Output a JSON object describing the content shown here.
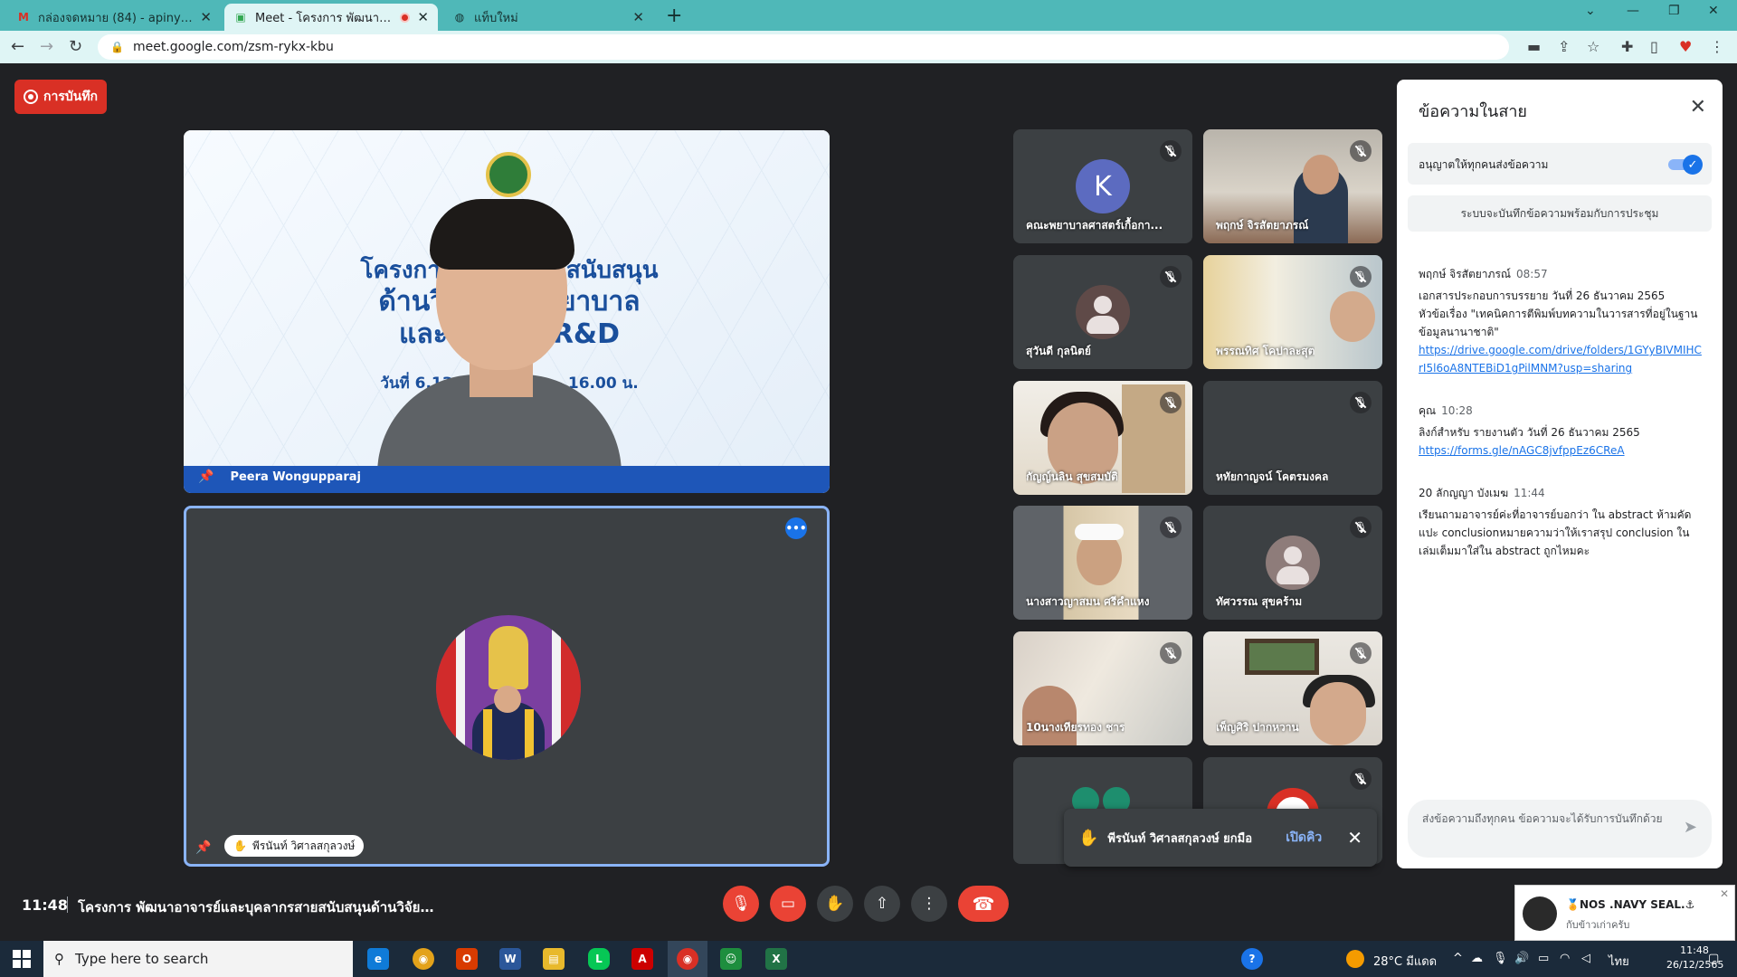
{
  "browser": {
    "tabs": [
      {
        "title": "กล่องจดหมาย (84) - apinya.kae@n",
        "favicon": "gmail-icon"
      },
      {
        "title": "Meet - โครงการ พัฒนาอาจารย์",
        "favicon": "meet-icon",
        "recording": true
      },
      {
        "title": "แท็บใหม่",
        "favicon": "globe-icon"
      }
    ],
    "url": "meet.google.com/zsm-rykx-kbu"
  },
  "meet": {
    "record_label": "การบันทึก",
    "main_tile": {
      "name": "Peera Wongupparaj",
      "slide": {
        "line1": "โครงการพัฒ          กรสายสนับสนุน",
        "line2": "ด้านวิจัยเ              การพยาบาล",
        "line3": "และการ            2R R&D",
        "line4": "วันที่ 6,13,19,2             .00 น. - 16.00 น."
      }
    },
    "second_tile": {
      "name": "พีรนันท์ วิศาลสกุลวงษ์"
    },
    "grid": [
      {
        "name": "คณะพยาบาลศาสตร์เกื้อกา...",
        "type": "letter",
        "letter": "K"
      },
      {
        "name": "พฤกษ์ จิรสัตยาภรณ์",
        "type": "office"
      },
      {
        "name": "สุวันดี กุลนิตย์",
        "type": "person"
      },
      {
        "name": "พรรณทิศ โคปาละสุต",
        "type": "room"
      },
      {
        "name": "กัญญ์นลิน สุขสมบัติ",
        "type": "shelf"
      },
      {
        "name": "หทัยกาญจน์ โคตรมงคล",
        "type": "blank"
      },
      {
        "name": "นางสาวญาสมน ศรีคำแหง",
        "type": "nurse"
      },
      {
        "name": "ทัศวรรณ สุขคร้าม",
        "type": "person2"
      },
      {
        "name": "10นางเทียรทอง ชาร",
        "type": "wall"
      },
      {
        "name": "เพ็ญศิริ ปากหวาน",
        "type": "art"
      },
      {
        "name": "",
        "type": "group"
      },
      {
        "name": "",
        "type": "red"
      }
    ],
    "toast": {
      "message": "พีรนันท์ วิศาลสกุลวงษ์ ยกมือ",
      "action": "เปิดคิว"
    },
    "chat": {
      "title": "ข้อความในสาย",
      "permission_label": "อนุญาตให้ทุกคนส่งข้อความ",
      "info": "ระบบจะบันทึกข้อความพร้อมกับการประชุม",
      "messages": [
        {
          "sender": "พฤกษ์ จิรสัตยาภรณ์",
          "time": "08:57",
          "lines": [
            "เอกสารประกอบการบรรยาย วันที่ 26 ธันวาคม 2565",
            "หัวข้อเรื่อง \"เทคนิคการตีพิมพ์บทความในวารสารที่อยู่ในฐาน",
            "ข้อมูลนานาชาติ\""
          ],
          "link": "https://drive.google.com/drive/folders/1GYyBIVMIHCrI5l6oA8NTEBiD1gPilMNM?usp=sharing"
        },
        {
          "sender": "คุณ",
          "time": "10:28",
          "lines": [
            "ลิงก์สำหรับ รายงานตัว วันที่ 26 ธันวาคม 2565"
          ],
          "link": "https://forms.gle/nAGC8jvfppEz6CReA"
        },
        {
          "sender": "20 ลักญญา บังเมฆ",
          "time": "11:44",
          "lines": [
            "เรียนถามอาจารย์ค่ะที่อาจารย์บอกว่า ใน abstract ห้ามคัด",
            "แปะ conclusionหมายความว่าให้เราสรุป conclusion ใน",
            "เล่มเต็มมาใส่ใน abstract ถูกไหมคะ"
          ],
          "link": ""
        }
      ],
      "composer_placeholder": "ส่งข้อความถึงทุกคน ข้อความจะได้รับการบันทึกด้วย"
    },
    "bottom": {
      "time": "11:48",
      "meeting_name": "โครงการ พัฒนาอาจารย์และบุคลากรสายสนับสนุนด้านวิจัยแ..."
    }
  },
  "notification": {
    "title": "🏅NOS .NAVY SEAL.⚓",
    "body": "กับข้าวเก่าครับ"
  },
  "taskbar": {
    "search_placeholder": "Type here to search",
    "weather": "28°C มีแดด",
    "lang": "ไทย",
    "time": "11:48",
    "date": "26/12/2565"
  },
  "colors": {
    "accent": "#1a73e8",
    "danger": "#ea4335",
    "tabbar": "#4fb8b8"
  }
}
